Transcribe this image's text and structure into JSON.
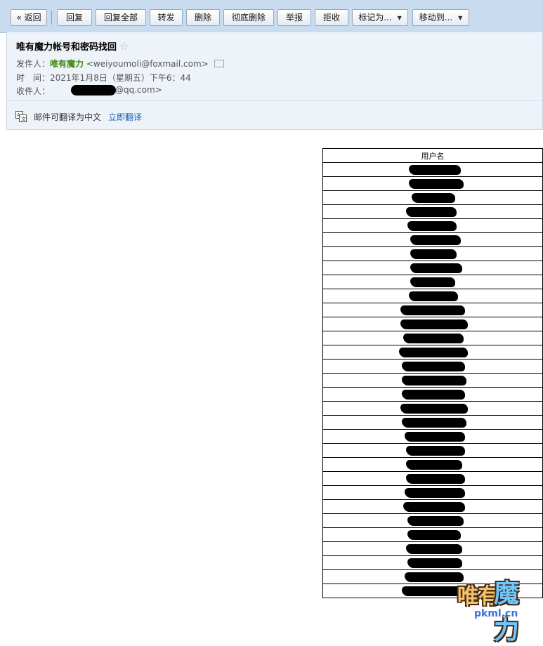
{
  "toolbar": {
    "buttons": [
      {
        "label": "« 返回"
      },
      {
        "label": "回复"
      },
      {
        "label": "回复全部"
      },
      {
        "label": "转发"
      },
      {
        "label": "删除"
      },
      {
        "label": "彻底删除"
      },
      {
        "label": "举报"
      },
      {
        "label": "拒收"
      },
      {
        "label": "标记为..."
      },
      {
        "label": "移动到..."
      }
    ]
  },
  "email": {
    "subject": "唯有魔力帐号和密码找回",
    "from_label": "发件人：",
    "from_name": "唯有魔力",
    "from_address": "<weiyoumoli@foxmail.com>",
    "time_label": "时　间：",
    "time_value": "2021年1月8日（星期五）下午6：44",
    "to_label": "收件人：",
    "to_address_visible": "@qq.com>"
  },
  "translate": {
    "text": "邮件可翻译为中文",
    "link": "立即翻译"
  },
  "user_table": {
    "header": "用户名",
    "row_count": 31
  },
  "watermark": {
    "chars_left": "唯有",
    "chars_right": "魔力",
    "url": "pkml.cn"
  }
}
